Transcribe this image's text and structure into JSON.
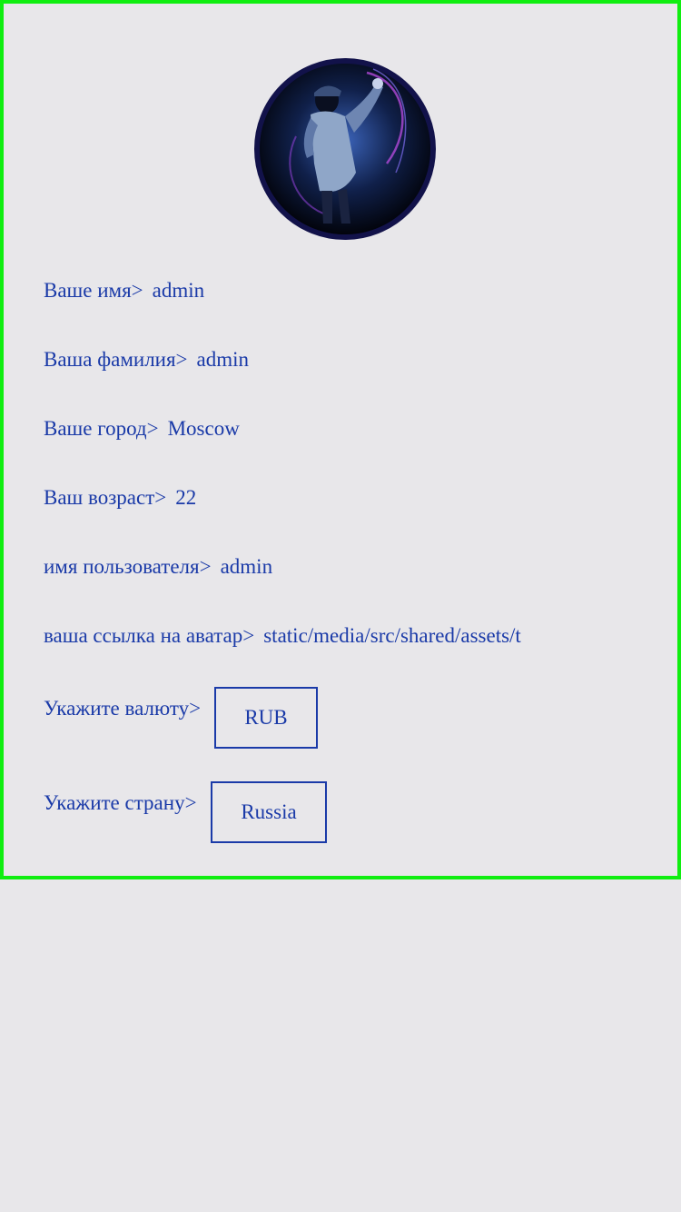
{
  "profile": {
    "avatar_alt": "avatar",
    "fields": {
      "first_name": {
        "label": "Ваше имя>",
        "value": "admin"
      },
      "last_name": {
        "label": "Ваша фамилия>",
        "value": "admin"
      },
      "city": {
        "label": "Ваше город>",
        "value": "Moscow"
      },
      "age": {
        "label": "Ваш возраст>",
        "value": "22"
      },
      "username": {
        "label": "имя пользователя>",
        "value": "admin"
      },
      "avatar_link": {
        "label": "ваша ссылка на аватар>",
        "value": "static/media/src/shared/assets/t"
      }
    },
    "currency": {
      "label": "Укажите валюту>",
      "selected": "RUB"
    },
    "country": {
      "label": "Укажите страну>",
      "selected": "Russia"
    }
  },
  "colors": {
    "text": "#1a3aa8",
    "background": "#e8e7ea",
    "card_border": "#10ee10"
  }
}
